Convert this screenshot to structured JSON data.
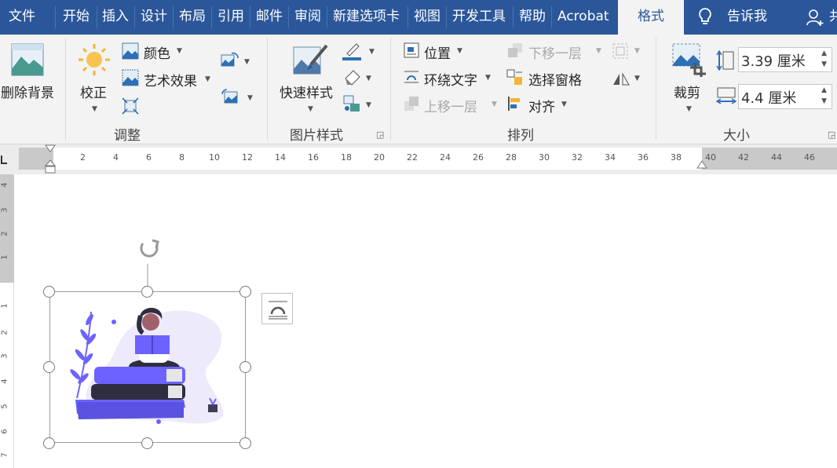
{
  "tabs": [
    {
      "label": "文件"
    },
    {
      "label": "开始"
    },
    {
      "label": "插入"
    },
    {
      "label": "设计"
    },
    {
      "label": "布局"
    },
    {
      "label": "引用"
    },
    {
      "label": "邮件"
    },
    {
      "label": "审阅"
    },
    {
      "label": "新建选项卡"
    },
    {
      "label": "视图"
    },
    {
      "label": "开发工具"
    },
    {
      "label": "帮助"
    },
    {
      "label": "Acrobat"
    },
    {
      "label": "格式"
    }
  ],
  "tell_me": "告诉我",
  "share_partial": "共",
  "adjust": {
    "remove_bg": "删除背景",
    "corrections": "校正",
    "color": "颜色",
    "artistic": "艺术效果",
    "group": "调整"
  },
  "styles": {
    "quick_styles": "快速样式",
    "group": "图片样式"
  },
  "arrange": {
    "position": "位置",
    "wrap_text": "环绕文字",
    "bring_forward": "上移一层",
    "send_backward": "下移一层",
    "selection_pane": "选择窗格",
    "align": "对齐",
    "group": "排列"
  },
  "size": {
    "crop": "裁剪",
    "height": "3.39 厘米",
    "width": "4.4 厘米",
    "group": "大小"
  },
  "ruler": {
    "h_numbers": [
      "2",
      "4",
      "6",
      "8",
      "10",
      "12",
      "14",
      "16",
      "18",
      "20",
      "22",
      "24",
      "26",
      "28",
      "30",
      "32",
      "34",
      "36",
      "38",
      "40",
      "42",
      "44",
      "46"
    ],
    "v_numbers": [
      "4",
      "3",
      "2",
      "1",
      "1",
      "1",
      "2",
      "3",
      "4",
      "5",
      "6",
      "7"
    ]
  },
  "colors": {
    "tab_bar": "#2b579a",
    "illustration_purple": "#6c63ff"
  }
}
